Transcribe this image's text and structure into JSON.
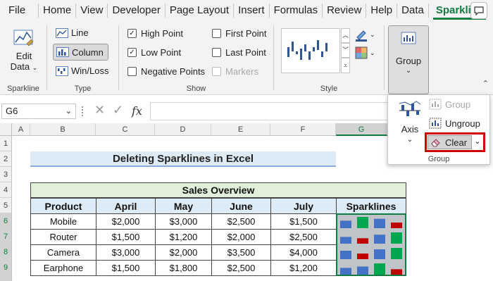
{
  "tabs": [
    "File",
    "Home",
    "View",
    "Developer",
    "Page Layout",
    "Insert",
    "Formulas",
    "Review",
    "Help",
    "Data",
    "Sparkline"
  ],
  "active_tab": "Sparkline",
  "ribbon": {
    "sparkline_group": {
      "edit_data_line1": "Edit",
      "edit_data_line2": "Data",
      "label": "Sparkline"
    },
    "type_group": {
      "line": "Line",
      "column": "Column",
      "winloss": "Win/Loss",
      "label": "Type"
    },
    "show_group": {
      "high_point": "High Point",
      "low_point": "Low Point",
      "negative_points": "Negative Points",
      "first_point": "First Point",
      "last_point": "Last Point",
      "markers": "Markers",
      "label": "Show"
    },
    "style_group": {
      "label": "Style"
    },
    "group_group": {
      "button": "Group",
      "label": "Group"
    }
  },
  "flyout": {
    "axis": "Axis",
    "group": "Group",
    "ungroup": "Ungroup",
    "clear": "Clear",
    "label": "Group"
  },
  "namebox": "G6",
  "fx": "fx",
  "columns": [
    "A",
    "B",
    "C",
    "D",
    "E",
    "F",
    "G"
  ],
  "rows": [
    "1",
    "2",
    "3",
    "4",
    "5",
    "6",
    "7",
    "8",
    "9"
  ],
  "sheet": {
    "title": "Deleting Sparklines in Excel",
    "table_title": "Sales Overview",
    "headers": [
      "Product",
      "April",
      "May",
      "June",
      "July",
      "Sparklines"
    ],
    "data": [
      [
        "Mobile",
        "$2,000",
        "$3,000",
        "$2,500",
        "$1,500"
      ],
      [
        "Router",
        "$1,500",
        "$1,200",
        "$2,000",
        "$2,500"
      ],
      [
        "Camera",
        "$3,000",
        "$2,000",
        "$3,500",
        "$4,000"
      ],
      [
        "Earphone",
        "$1,500",
        "$1,800",
        "$2,500",
        "$1,200"
      ]
    ]
  },
  "colors": {
    "accent": "#107c41",
    "highlight_box": "#d00000",
    "spark_bar": "#4472c4",
    "spark_high": "#00a650",
    "spark_low": "#c00000"
  }
}
